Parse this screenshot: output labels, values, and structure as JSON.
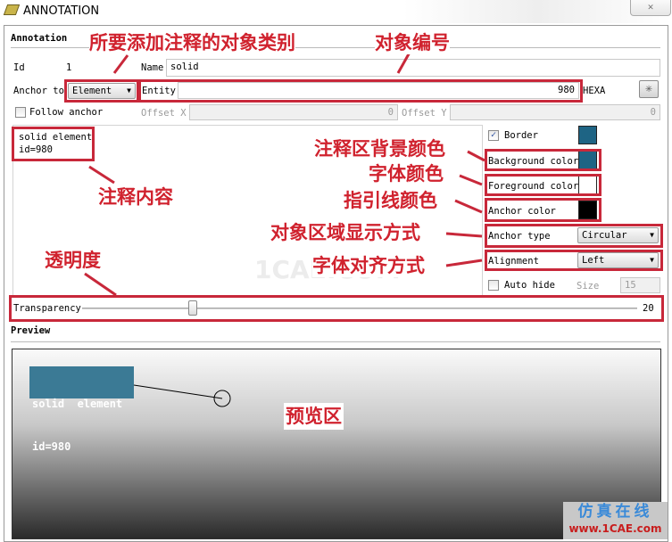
{
  "window": {
    "title": "ANNOTATION",
    "close_icon": "close-icon"
  },
  "group": {
    "title": "Annotation"
  },
  "form": {
    "id_label": "Id",
    "id_value": "1",
    "name_label": "Name",
    "name_value": "solid",
    "anchor_to_label": "Anchor to",
    "anchor_to_value": "Element",
    "entity_label": "Entity",
    "entity_value": "980",
    "hexa_label": "HEXA",
    "follow_anchor_label": "Follow anchor",
    "follow_anchor_checked": false,
    "offset_x_label": "Offset X",
    "offset_x_value": "0",
    "offset_y_label": "Offset Y",
    "offset_y_value": "0",
    "text_line1": "solid element",
    "text_line2": "id=980"
  },
  "right": {
    "border_label": "Border",
    "border_checked": true,
    "border_color": "#1e6484",
    "bg_label": "Background color",
    "bg_color": "#1e6484",
    "fg_label": "Foreground color",
    "fg_color": "#ffffff",
    "anchor_color_label": "Anchor color",
    "anchor_color": "#000000",
    "anchor_type_label": "Anchor type",
    "anchor_type_value": "Circular",
    "alignment_label": "Alignment",
    "alignment_value": "Left",
    "auto_hide_label": "Auto hide",
    "auto_hide_checked": false,
    "size_label": "Size",
    "size_value": "15"
  },
  "transparency": {
    "label": "Transparency",
    "value": "20",
    "max": 100
  },
  "preview": {
    "title": "Preview",
    "line1": "solid  element",
    "line2": "id=980"
  },
  "annotations": {
    "object_type": "所要添加注释的对象类别",
    "object_id": "对象编号",
    "content": "注释内容",
    "bg": "注释区背景颜色",
    "font_color": "字体颜色",
    "leader_color": "指引线颜色",
    "display": "对象区域显示方式",
    "align": "字体对齐方式",
    "transparency": "透明度",
    "preview": "预览区"
  },
  "watermark": {
    "center": "1CAE.COM",
    "cn": "仿真在线",
    "url": "www.1CAE.com"
  }
}
